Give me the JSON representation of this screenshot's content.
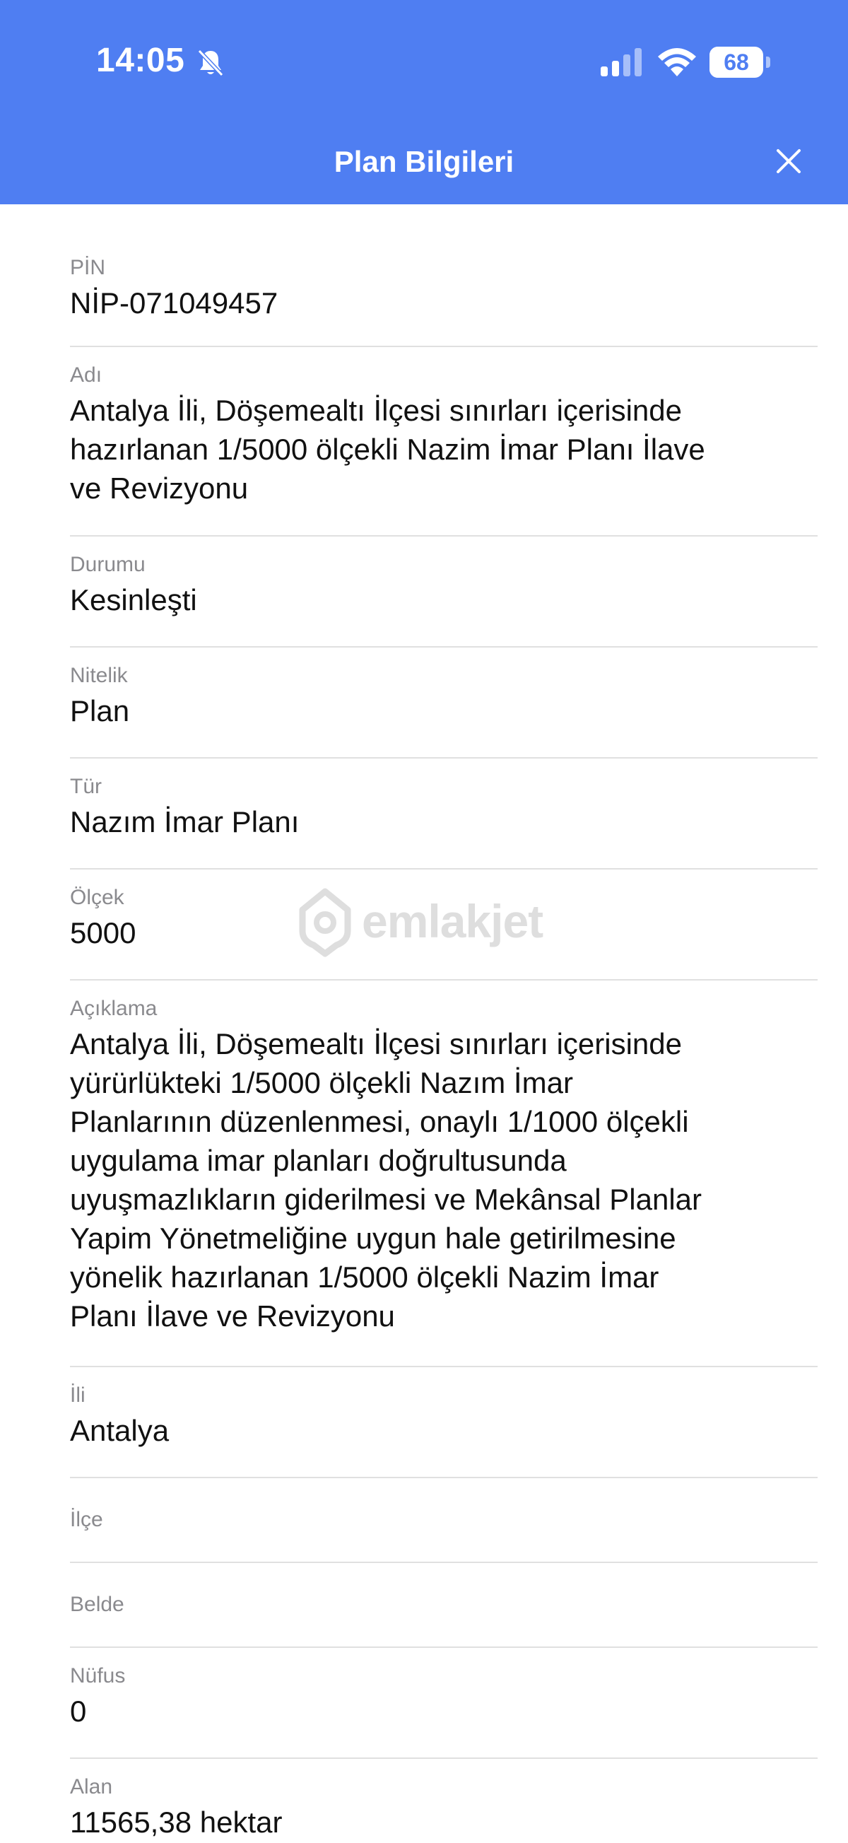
{
  "status_bar": {
    "time": "14:05",
    "battery_level": "68",
    "battery_percent": 68
  },
  "header": {
    "title": "Plan Bilgileri",
    "background_color": "#4f7ef2"
  },
  "fields": [
    {
      "label": "PİN",
      "value": "NİP-071049457"
    },
    {
      "label": "Adı",
      "value": "Antalya İli, Döşemealtı İlçesi sınırları içerisinde\nhazırlanan 1/5000 ölçekli Nazim İmar Planı İlave\nve Revizyonu"
    },
    {
      "label": "Durumu",
      "value": "Kesinleşti"
    },
    {
      "label": "Nitelik",
      "value": "Plan"
    },
    {
      "label": "Tür",
      "value": "Nazım İmar Planı"
    },
    {
      "label": "Ölçek",
      "value": "5000"
    },
    {
      "label": "Açıklama",
      "value": "Antalya İli, Döşemealtı İlçesi sınırları içerisinde\nyürürlükteki 1/5000 ölçekli Nazım İmar\nPlanlarının düzenlenmesi, onaylı 1/1000 ölçekli\nuygulama imar planları doğrultusunda\nuyuşmazlıkların giderilmesi ve Mekânsal Planlar\nYapim Yönetmeliğine uygun hale getirilmesine\nyönelik hazırlanan 1/5000 ölçekli Nazim İmar\nPlanı İlave ve Revizyonu"
    },
    {
      "label": "İli",
      "value": "Antalya"
    },
    {
      "label": "İlçe",
      "value": ""
    },
    {
      "label": "Belde",
      "value": ""
    },
    {
      "label": "Nüfus",
      "value": "0"
    },
    {
      "label": "Alan",
      "value": "11565,38 hektar"
    }
  ],
  "watermark": {
    "text": "emlakjet"
  }
}
